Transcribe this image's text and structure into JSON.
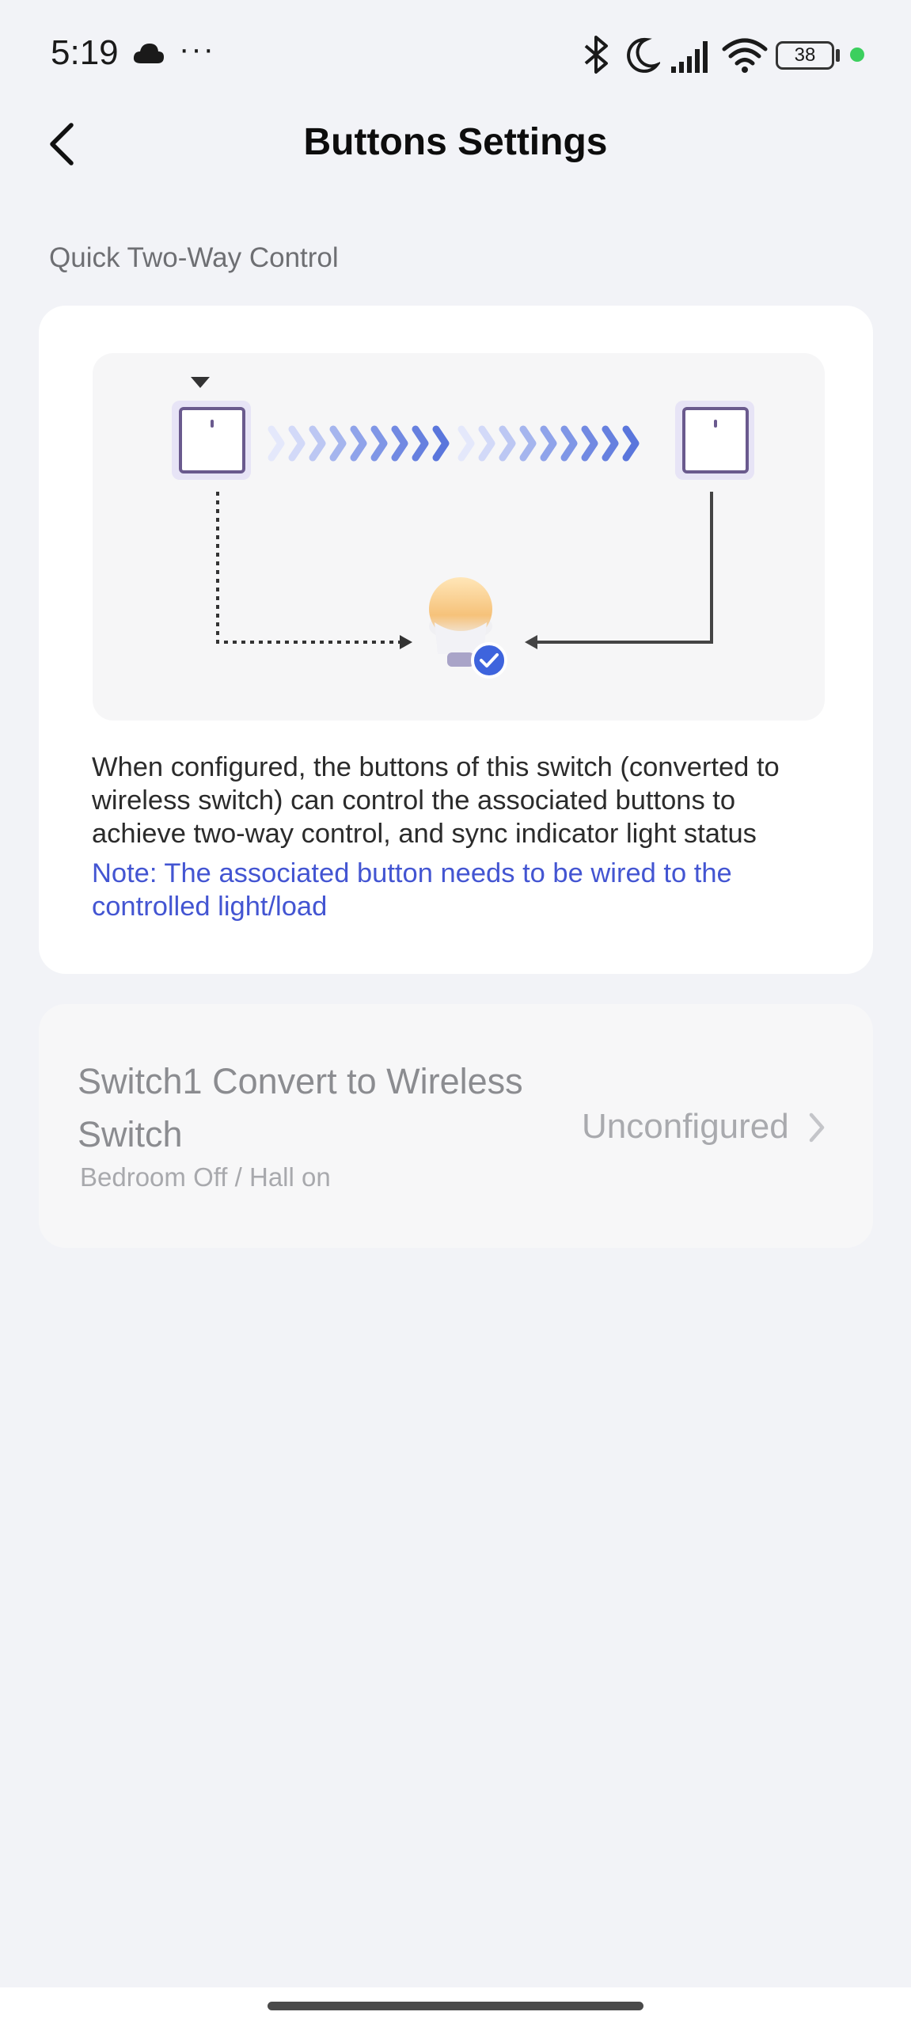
{
  "status_bar": {
    "time": "5:19",
    "more": "···",
    "battery": "38",
    "icons": [
      "cloud-icon",
      "bluetooth-icon",
      "moon-icon",
      "signal-icon",
      "wifi-icon",
      "battery-icon"
    ],
    "dot_color": "#3ccf5e"
  },
  "header": {
    "title": "Buttons Settings",
    "back_icon": "chevron-left-icon"
  },
  "section": {
    "label": "Quick Two-Way Control"
  },
  "info_card": {
    "description": "When configured, the buttons of this switch (converted to wireless switch) can control the associated buttons to achieve two-way control, and sync indicator light status",
    "note": "Note: The associated button needs to be wired to the controlled light/load",
    "note_color": "#4355d2"
  },
  "switch_row": {
    "title": "Switch1 Convert to Wireless Switch",
    "subtitle": "Bedroom Off / Hall on",
    "status": "Unconfigured",
    "chevron_icon": "chevron-right-icon"
  }
}
